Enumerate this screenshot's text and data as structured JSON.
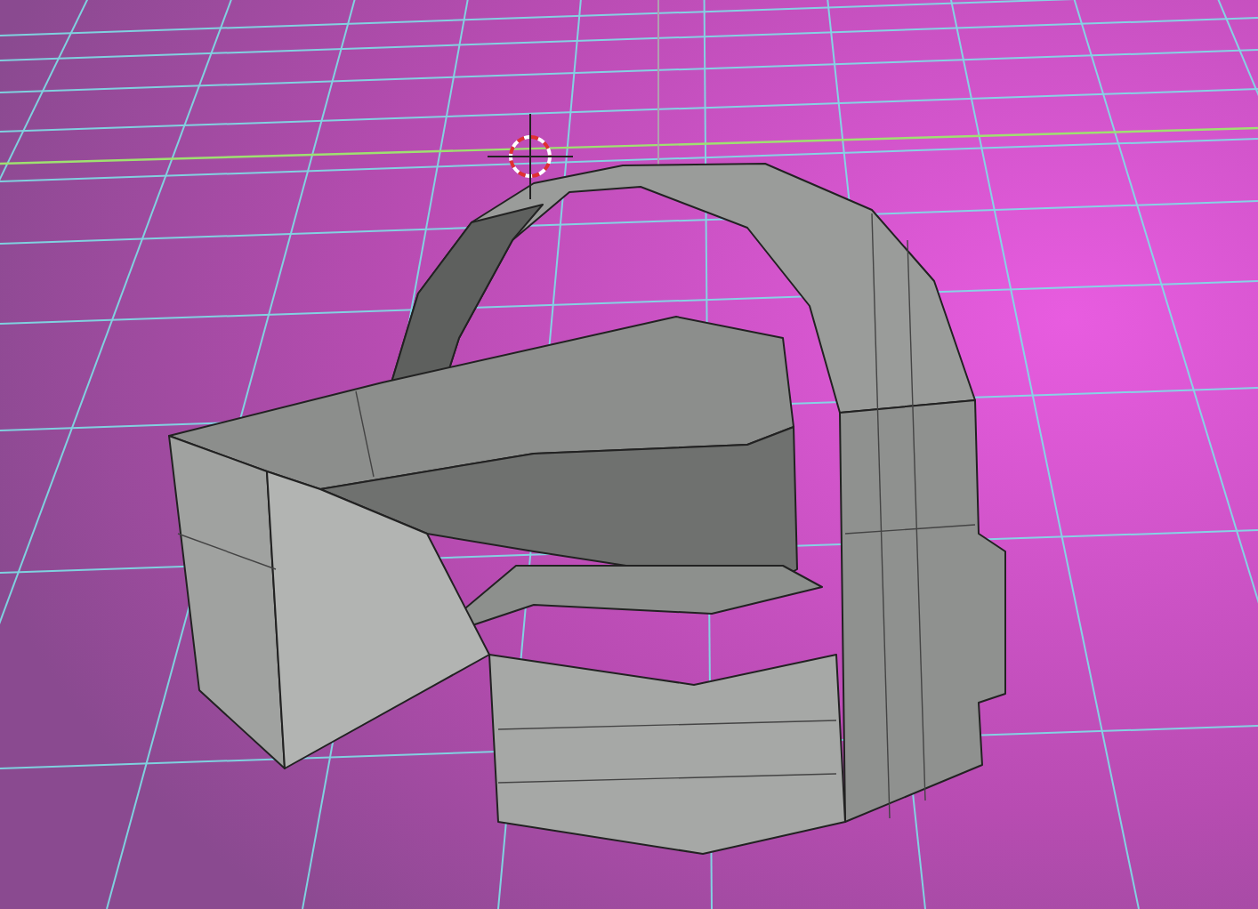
{
  "viewport": {
    "grid": true,
    "cursor_3d": true,
    "model": true
  }
}
